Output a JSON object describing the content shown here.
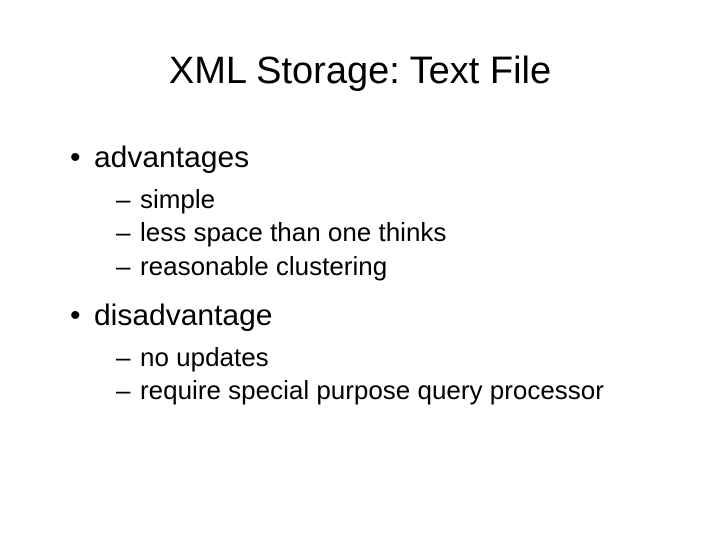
{
  "title": "XML Storage: Text File",
  "sections": [
    {
      "heading": "advantages",
      "items": [
        "simple",
        "less space than one thinks",
        "reasonable clustering"
      ]
    },
    {
      "heading": "disadvantage",
      "items": [
        "no updates",
        "require special purpose query processor"
      ]
    }
  ]
}
